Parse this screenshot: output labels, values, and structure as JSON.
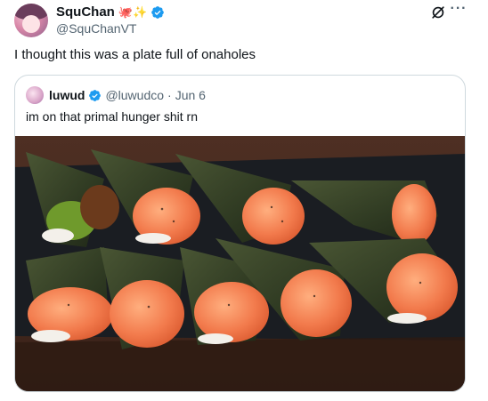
{
  "tweet": {
    "display_name": "SquChan",
    "name_emojis": "🐙✨",
    "handle": "@SquChanVT",
    "text": "I thought this was a plate full of onaholes",
    "more_label": "···"
  },
  "quoted": {
    "display_name": "luwud",
    "handle": "@luwudco",
    "separator": "·",
    "date": "Jun 6",
    "text": "im on that primal hunger shit rn"
  },
  "colors": {
    "verified": "#1d9bf0",
    "secondary_text": "#536471",
    "border": "#cfd9de"
  },
  "icons": {
    "verified": "verified-badge-icon",
    "grok": "grok-icon",
    "more": "more-icon"
  }
}
